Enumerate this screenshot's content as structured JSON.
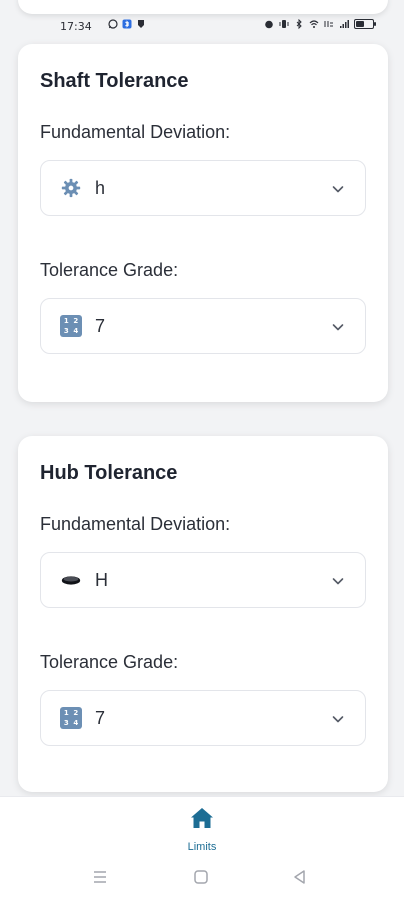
{
  "status_bar": {
    "time": "17:34",
    "battery_level": 0.45
  },
  "shaft": {
    "title": "Shaft Tolerance",
    "deviation_label": "Fundamental Deviation:",
    "deviation_value": "h",
    "deviation_icon": "gear-icon",
    "grade_label": "Tolerance Grade:",
    "grade_value": "7",
    "grade_icon": "numbers-icon"
  },
  "hub": {
    "title": "Hub Tolerance",
    "deviation_label": "Fundamental Deviation:",
    "deviation_value": "H",
    "deviation_icon": "hole-icon",
    "grade_label": "Tolerance Grade:",
    "grade_value": "7",
    "grade_icon": "numbers-icon"
  },
  "number_icon_digits": [
    "1",
    "2",
    "3",
    "4"
  ],
  "bottom_nav": {
    "items": [
      {
        "label": "Limits",
        "icon": "home-icon",
        "active": true
      }
    ],
    "active_color": "#1d6d94"
  }
}
